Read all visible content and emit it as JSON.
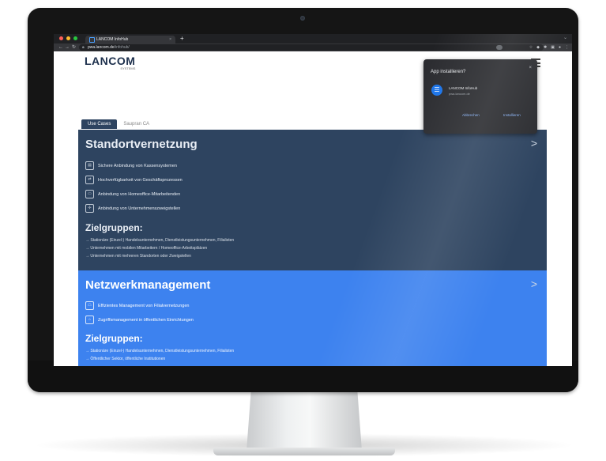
{
  "browser": {
    "tab_title": "LANCOM InfoHub",
    "tab_close": "×",
    "new_tab": "+",
    "url_domain": "pwa.lancom.de",
    "url_path": "/infohub/"
  },
  "header": {
    "logo": "LANCOM",
    "logo_sub": "SYSTEMS"
  },
  "page_tabs": [
    "Use Cases",
    "Saupran CA"
  ],
  "card1": {
    "title": "Standortvernetzung",
    "arrow": ">",
    "features": [
      "Sichere Anbindung von Kassensystemen",
      "Hochverfügbarkeit von Geschäftsprozessen",
      "Anbindung von Homeoffice-Mitarbeitenden",
      "Anbindung von Unternehmenszweigstellen"
    ],
    "target_title": "Zielgruppen:",
    "targets": [
      "→ Stationäre (Einzel-) Handelsunternehmen, Dienstleistungsunternehmen, Filialisten",
      "→ Unternehmen mit mobilen Mitarbeitern / Homeoffice-Arbeitsplätzen",
      "→ Unternehmen mit mehreren Standorten oder Zweigstellen"
    ]
  },
  "card2": {
    "title": "Netzwerkmanagement",
    "arrow": ">",
    "features": [
      "Effizientes Management von Filialvernetzungen",
      "Zugriffsmanagement in öffentlichen Einrichtungen"
    ],
    "target_title": "Zielgruppen:",
    "targets": [
      "→ Stationäre (Einzel-) Handelsunternehmen, Dienstleistungsunternehmen, Filialisten",
      "→ Öffentlicher Sektor, öffentliche Institutionen"
    ]
  },
  "popup": {
    "title": "App installieren?",
    "close": "×",
    "app_name": "LANCOM InfoHub",
    "domain": "pwa.lancom.de",
    "cancel": "Abbrechen",
    "install": "Installieren"
  },
  "colors": {
    "card1_bg": "#2e4460",
    "card2_bg": "#3d82ef",
    "popup_bg": "#2b2c30",
    "accent": "#1a73e8"
  }
}
